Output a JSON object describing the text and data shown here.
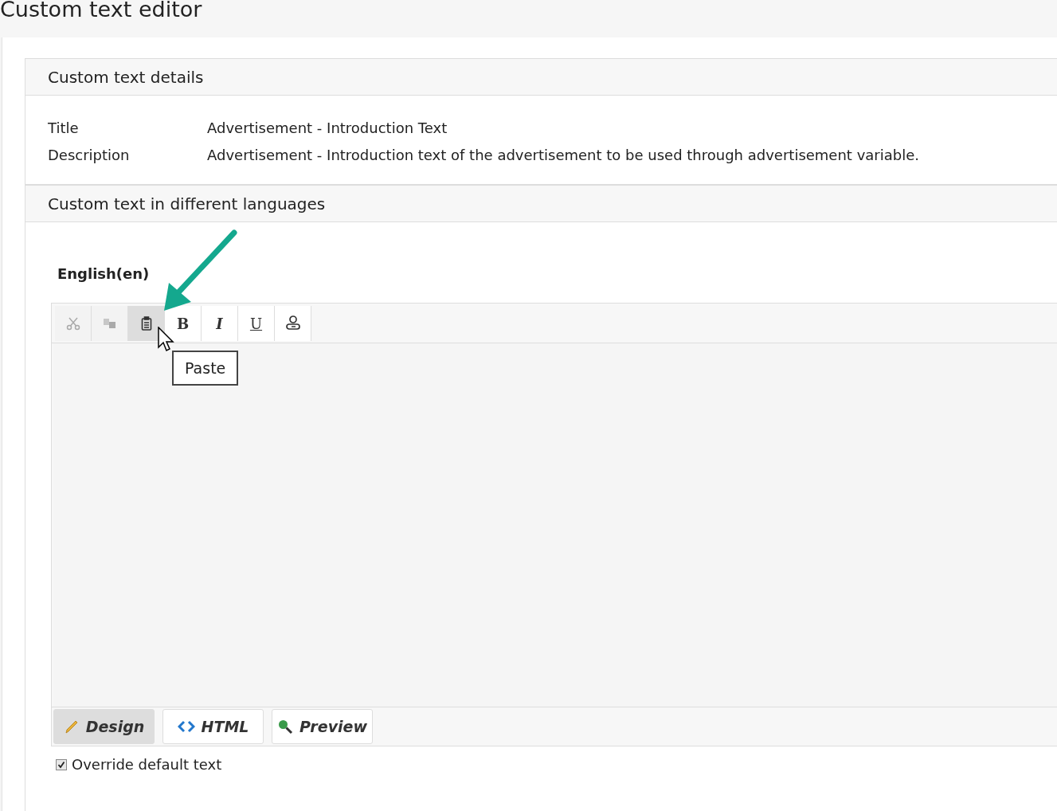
{
  "page_title": "Custom text editor",
  "details": {
    "heading": "Custom text details",
    "fields": [
      {
        "label": "Title",
        "value": "Advertisement - Introduction Text"
      },
      {
        "label": "Description",
        "value": "Advertisement - Introduction text of the advertisement to be used through advertisement variable."
      }
    ]
  },
  "languages": {
    "heading": "Custom text in different languages",
    "language": "English(en)",
    "toolbar": [
      {
        "kind": "cut",
        "disabled": true,
        "hovered": false
      },
      {
        "kind": "copy",
        "disabled": true,
        "hovered": false
      },
      {
        "kind": "paste",
        "disabled": false,
        "hovered": true
      },
      {
        "kind": "bold",
        "glyph": "B",
        "disabled": false,
        "hovered": false
      },
      {
        "kind": "italic",
        "glyph": "I",
        "disabled": false,
        "hovered": false
      },
      {
        "kind": "underline",
        "glyph": "U",
        "disabled": false,
        "hovered": false
      },
      {
        "kind": "spell",
        "disabled": false,
        "hovered": false
      }
    ],
    "tooltip": "Paste",
    "modes": [
      {
        "kind": "design",
        "label": "Design",
        "selected": true
      },
      {
        "kind": "html",
        "label": "HTML",
        "selected": false
      },
      {
        "kind": "preview",
        "label": "Preview",
        "selected": false
      }
    ],
    "override": {
      "label": "Override default text",
      "checked": true
    }
  }
}
